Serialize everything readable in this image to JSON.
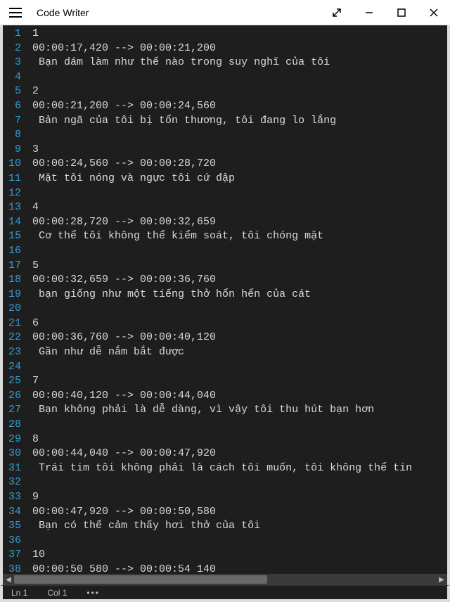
{
  "window": {
    "title": "Code Writer"
  },
  "lines": [
    "1",
    "00:00:17,420 --> 00:00:21,200",
    " Bạn dám làm như thế nào trong suy nghĩ của tôi",
    "",
    "2",
    "00:00:21,200 --> 00:00:24,560",
    " Bản ngã của tôi bị tổn thương, tôi đang lo lắng",
    "",
    "3",
    "00:00:24,560 --> 00:00:28,720",
    " Mặt tôi nóng và ngực tôi cứ đập",
    "",
    "4",
    "00:00:28,720 --> 00:00:32,659",
    " Cơ thể tôi không thể kiểm soát, tôi chóng mặt",
    "",
    "5",
    "00:00:32,659 --> 00:00:36,760",
    " bạn giống như một tiếng thở hổn hển của cát",
    "",
    "6",
    "00:00:36,760 --> 00:00:40,120",
    " Gần như dễ nắm bắt được",
    "",
    "7",
    "00:00:40,120 --> 00:00:44,040",
    " Bạn không phải là dễ dàng, vì vậy tôi thu hút bạn hơn",
    "",
    "8",
    "00:00:44,040 --> 00:00:47,920",
    " Trái tim tôi không phải là cách tôi muốn, tôi không thể tin",
    "",
    "9",
    "00:00:47,920 --> 00:00:50,580",
    " Bạn có thể cảm thấy hơi thở của tôi",
    "",
    "10",
    "00:00:50 580 --> 00:00:54 140"
  ],
  "status": {
    "ln": "Ln 1",
    "col": "Col 1",
    "more": "•••"
  }
}
